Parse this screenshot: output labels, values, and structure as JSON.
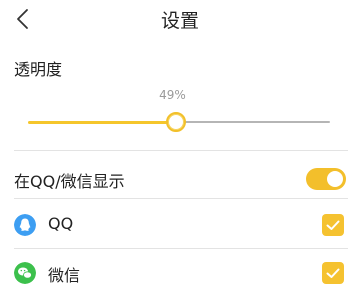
{
  "header": {
    "title": "设置"
  },
  "transparency": {
    "label": "透明度",
    "percent_text": "49%",
    "value_fraction": 0.49
  },
  "display_setting": {
    "label": "在QQ/微信显示",
    "enabled": true
  },
  "apps": [
    {
      "name": "QQ",
      "icon": "qq-icon",
      "checked": true,
      "icon_color": "#3d9ef2"
    },
    {
      "name": "微信",
      "icon": "wechat-icon",
      "checked": true,
      "icon_color": "#3cc04c"
    }
  ],
  "colors": {
    "accent": "#f3bf2b",
    "track_inactive": "#b5b5b5",
    "divider": "#e3e3e3"
  }
}
